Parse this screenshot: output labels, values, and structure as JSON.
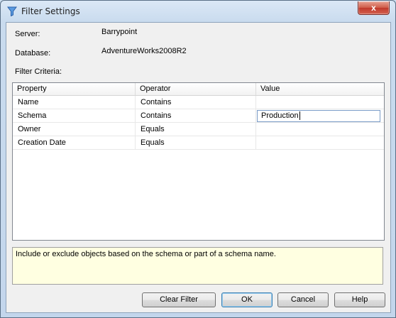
{
  "window": {
    "title": "Filter Settings",
    "close_glyph": "x"
  },
  "fields": {
    "server_label": "Server:",
    "server_value": "Barrypoint",
    "database_label": "Database:",
    "database_value": "AdventureWorks2008R2",
    "criteria_label": "Filter Criteria:"
  },
  "grid": {
    "columns": [
      "Property",
      "Operator",
      "Value"
    ],
    "rows": [
      {
        "property": "Name",
        "operator": "Contains",
        "value": ""
      },
      {
        "property": "Schema",
        "operator": "Contains",
        "value": "Production"
      },
      {
        "property": "Owner",
        "operator": "Equals",
        "value": ""
      },
      {
        "property": "Creation Date",
        "operator": "Equals",
        "value": ""
      }
    ]
  },
  "description": "Include or exclude objects based on the schema or part of a schema name.",
  "buttons": {
    "clear_filter": "Clear Filter",
    "ok": "OK",
    "cancel": "Cancel",
    "help": "Help"
  },
  "colors": {
    "description_bg": "#ffffe1",
    "close_button": "#c0392b",
    "filter_icon": "#3a7bd5"
  },
  "icons": {
    "title_icon": "filter-funnel-icon",
    "close_icon": "close-icon"
  }
}
